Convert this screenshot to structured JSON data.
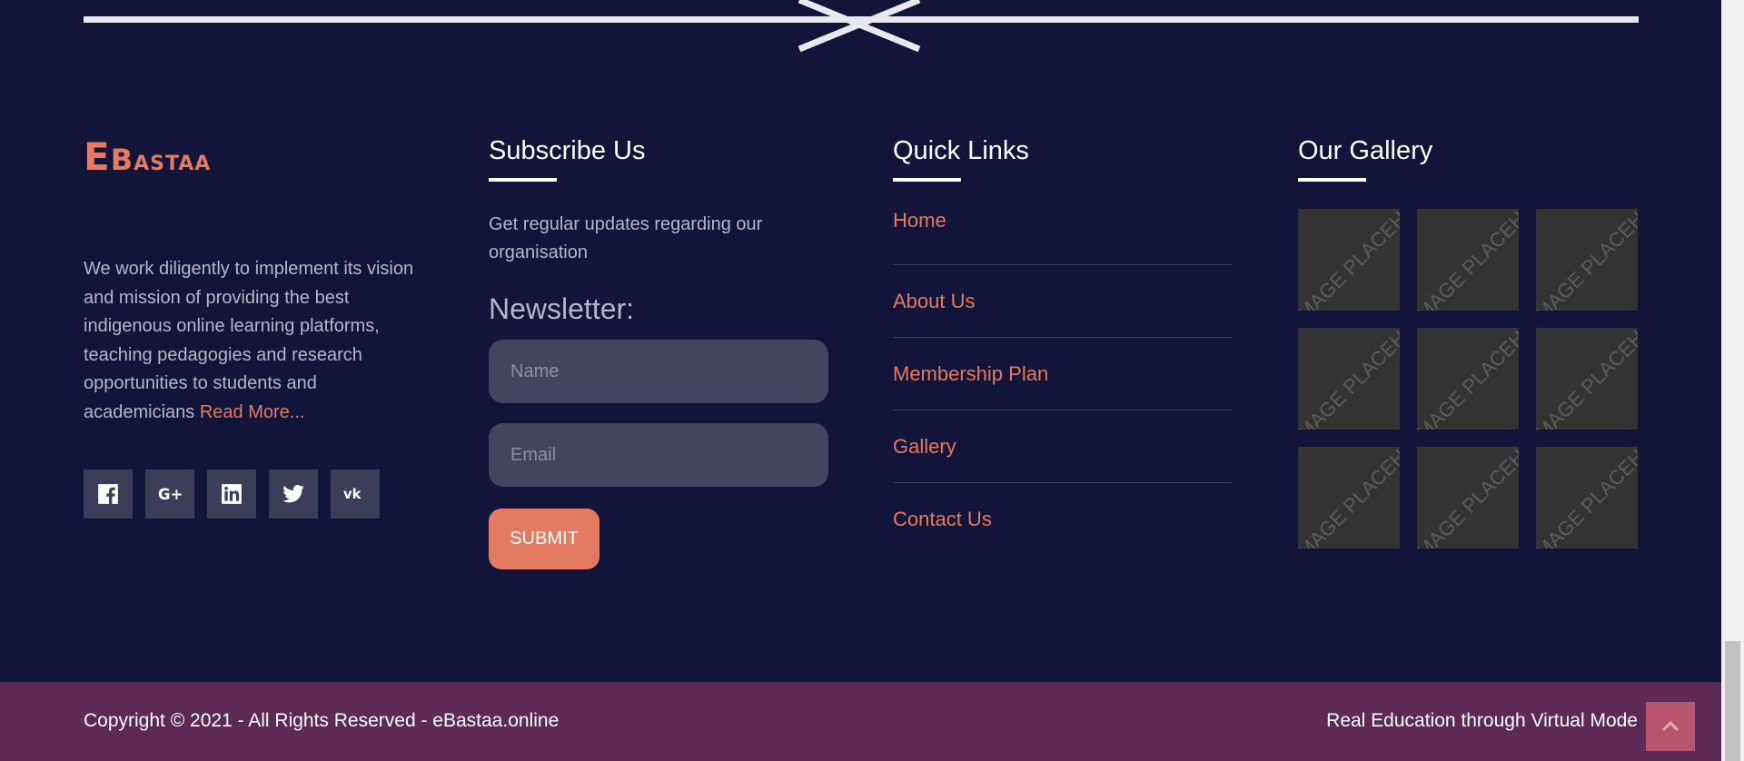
{
  "brand": {
    "logo_first": "E",
    "logo_rest": "Bastaa",
    "about": "We work diligently to implement its vision and mission of providing the best indigenous online learning platforms, teaching pedagogies and research opportunities to students and academicians",
    "read_more": "Read More...",
    "socials": [
      {
        "icon": "facebook-icon"
      },
      {
        "icon": "google-plus-icon"
      },
      {
        "icon": "linkedin-icon"
      },
      {
        "icon": "twitter-icon"
      },
      {
        "icon": "vk-icon"
      }
    ]
  },
  "subscribe": {
    "title": "Subscribe Us",
    "text": "Get regular updates regarding our organisation",
    "newsletter_label": "Newsletter:",
    "name_placeholder": "Name",
    "email_placeholder": "Email",
    "submit_label": "SUBMIT"
  },
  "quick_links": {
    "title": "Quick Links",
    "items": [
      {
        "label": "Home"
      },
      {
        "label": "About Us"
      },
      {
        "label": "Membership Plan"
      },
      {
        "label": "Gallery"
      },
      {
        "label": "Contact Us"
      }
    ]
  },
  "gallery": {
    "title": "Our Gallery",
    "placeholder_text": "IMAGE PLACEHOLDER"
  },
  "footer": {
    "copyright": "Copyright © 2021 - All Rights Reserved - eBastaa.online",
    "tagline": "Real Education through Virtual Mode"
  },
  "colors": {
    "background": "#12143a",
    "accent": "#e57a62",
    "footer_bar": "#5d2a58",
    "input_bg": "#43445f"
  }
}
